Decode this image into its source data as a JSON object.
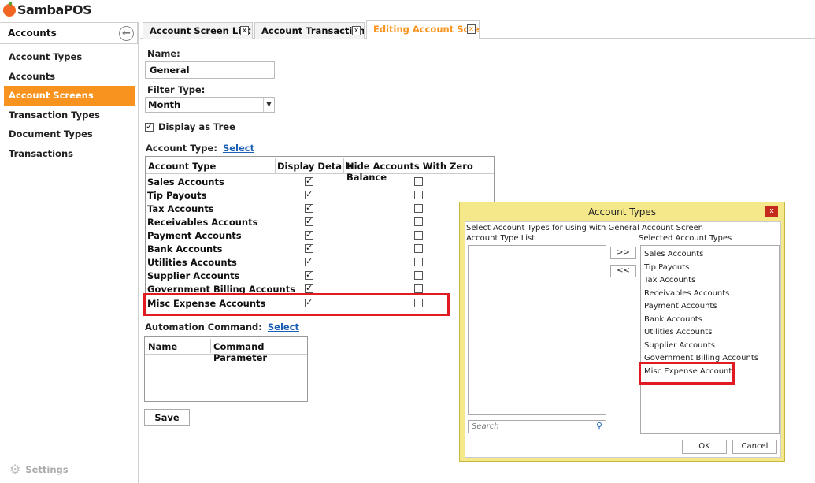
{
  "app": {
    "logo": "SambaPOS"
  },
  "sidebar": {
    "title": "Accounts",
    "items": [
      {
        "label": "Account Types",
        "active": false
      },
      {
        "label": "Accounts",
        "active": false
      },
      {
        "label": "Account Screens",
        "active": true
      },
      {
        "label": "Transaction Types",
        "active": false
      },
      {
        "label": "Document Types",
        "active": false
      },
      {
        "label": "Transactions",
        "active": false
      }
    ],
    "settings_label": "Settings"
  },
  "tabs": [
    {
      "label": "Account Screen List",
      "close": "x",
      "active": false
    },
    {
      "label": "Account Transaction",
      "close": "x",
      "active": false
    },
    {
      "label": "Editing Account Scre",
      "close": "x",
      "active": true
    }
  ],
  "form": {
    "name_label": "Name:",
    "name_value": "General",
    "filter_label": "Filter Type:",
    "filter_value": "Month",
    "display_tree_label": "Display as Tree",
    "display_tree_checked": true,
    "account_type_label": "Account Type:",
    "account_type_link": "Select",
    "grid_headers": [
      "Account Type",
      "Display Details",
      "Hide Accounts With Zero Balance"
    ],
    "grid_rows": [
      {
        "name": "Sales Accounts",
        "display": true,
        "hide": false
      },
      {
        "name": "Tip Payouts",
        "display": true,
        "hide": false
      },
      {
        "name": "Tax Accounts",
        "display": true,
        "hide": false
      },
      {
        "name": "Receivables Accounts",
        "display": true,
        "hide": false
      },
      {
        "name": "Payment Accounts",
        "display": true,
        "hide": false
      },
      {
        "name": "Bank Accounts",
        "display": true,
        "hide": false
      },
      {
        "name": "Utilities Accounts",
        "display": true,
        "hide": false
      },
      {
        "name": "Supplier Accounts",
        "display": true,
        "hide": false
      },
      {
        "name": "Government Billing Accounts",
        "display": true,
        "hide": false
      },
      {
        "name": "Misc Expense Accounts",
        "display": true,
        "hide": false
      }
    ],
    "automation_label": "Automation Command:",
    "automation_link": "Select",
    "automation_headers": [
      "Name",
      "Command Parameter"
    ],
    "save_label": "Save"
  },
  "dialog": {
    "title": "Account Types",
    "close": "x",
    "instruction": "Select Account Types for using with General Account Screen",
    "left_list_label": "Account Type List",
    "right_list_label": "Selected Account Types",
    "add_button": ">>",
    "remove_button": "<<",
    "search_placeholder": "Search",
    "selected": [
      "Sales Accounts",
      "Tip Payouts",
      "Tax Accounts",
      "Receivables Accounts",
      "Payment Accounts",
      "Bank Accounts",
      "Utilities Accounts",
      "Supplier Accounts",
      "Government Billing Accounts",
      "Misc Expense Accounts"
    ],
    "ok_label": "OK",
    "cancel_label": "Cancel"
  },
  "colors": {
    "accent": "#f7931e",
    "highlight": "#e11b22",
    "link": "#1a5fb4",
    "dialog_bg": "#f4e88a"
  }
}
